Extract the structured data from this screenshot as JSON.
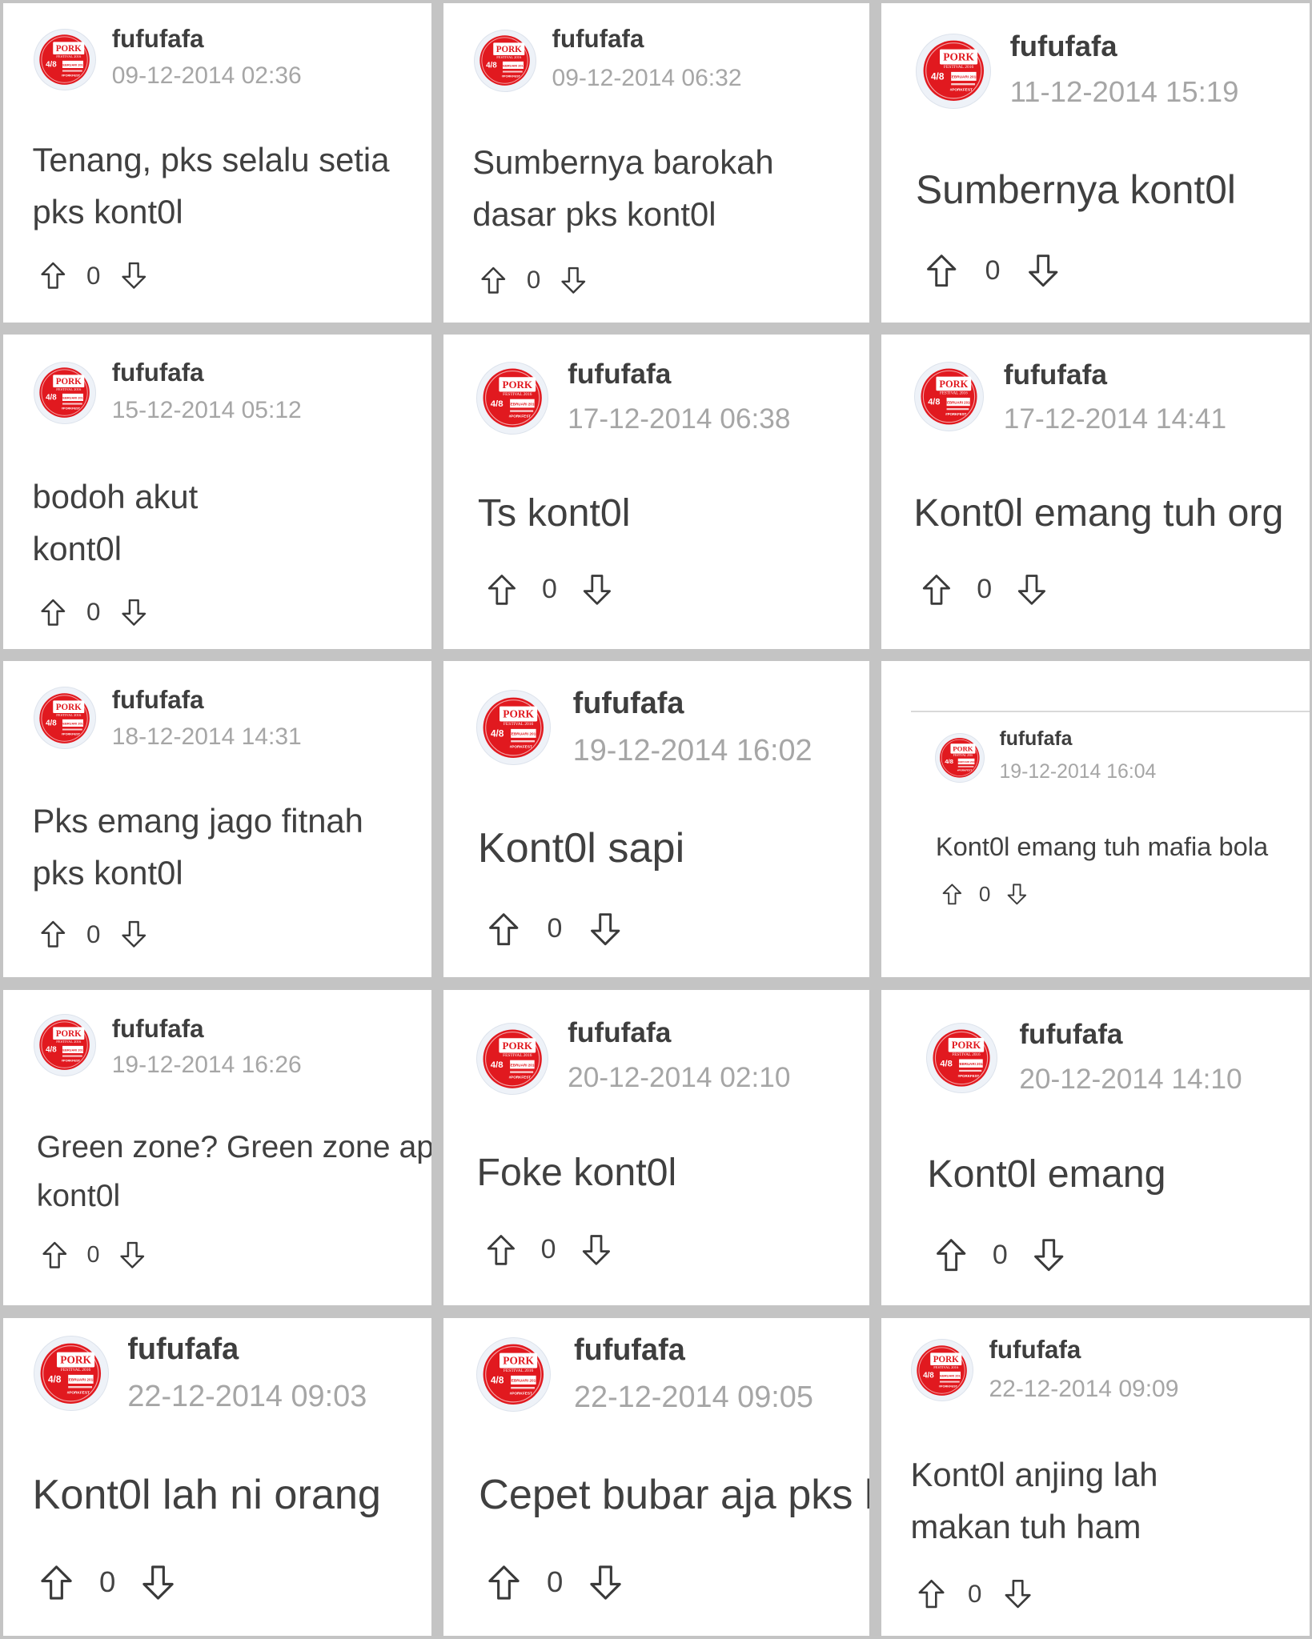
{
  "colors": {
    "background": "#c4c4c4",
    "card": "#ffffff",
    "username": "#3e3e3e",
    "timestamp": "#a6a6a6",
    "body_text": "#404040",
    "avatar_red": "#e1191f"
  },
  "icons": {
    "avatar": "pork-festival-badge",
    "upvote": "arrow-up-outline-icon",
    "downvote": "arrow-down-outline-icon"
  },
  "avatar_badge": {
    "title": "PORK",
    "subtitle": "FESTIVAL 2016",
    "date": "4/8",
    "month": "FEBRUARI 2016",
    "tag": "#PORKFEST"
  },
  "comments": [
    {
      "username": "fufufafa",
      "timestamp": "09-12-2014 02:36",
      "body": [
        "Tenang, pks selalu setia",
        "pks kont0l"
      ],
      "votes": "0"
    },
    {
      "username": "fufufafa",
      "timestamp": "09-12-2014 06:32",
      "body": [
        "Sumbernya barokah",
        "dasar pks kont0l"
      ],
      "votes": "0"
    },
    {
      "username": "fufufafa",
      "timestamp": "11-12-2014 15:19",
      "body": [
        "Sumbernya kont0l"
      ],
      "votes": "0"
    },
    {
      "username": "fufufafa",
      "timestamp": "15-12-2014 05:12",
      "body": [
        "bodoh akut",
        "kont0l"
      ],
      "votes": "0"
    },
    {
      "username": "fufufafa",
      "timestamp": "17-12-2014 06:38",
      "body": [
        "Ts kont0l"
      ],
      "votes": "0"
    },
    {
      "username": "fufufafa",
      "timestamp": "17-12-2014 14:41",
      "body": [
        "Kont0l emang tuh org"
      ],
      "votes": "0"
    },
    {
      "username": "fufufafa",
      "timestamp": "18-12-2014 14:31",
      "body": [
        "Pks emang jago fitnah",
        "pks kont0l"
      ],
      "votes": "0"
    },
    {
      "username": "fufufafa",
      "timestamp": "19-12-2014 16:02",
      "body": [
        "Kont0l sapi"
      ],
      "votes": "0"
    },
    {
      "username": "fufufafa",
      "timestamp": "19-12-2014 16:04",
      "body": [
        "Kont0l emang tuh mafia bola"
      ],
      "votes": "0"
    },
    {
      "username": "fufufafa",
      "timestamp": "19-12-2014 16:26",
      "body": [
        "Green zone? Green zone ap",
        "kont0l"
      ],
      "votes": "0"
    },
    {
      "username": "fufufafa",
      "timestamp": "20-12-2014 02:10",
      "body": [
        "Foke kont0l"
      ],
      "votes": "0"
    },
    {
      "username": "fufufafa",
      "timestamp": "20-12-2014 14:10",
      "body": [
        "Kont0l emang"
      ],
      "votes": "0"
    },
    {
      "username": "fufufafa",
      "timestamp": "22-12-2014 09:03",
      "body": [
        "Kont0l lah ni orang"
      ],
      "votes": "0"
    },
    {
      "username": "fufufafa",
      "timestamp": "22-12-2014 09:05",
      "body": [
        "Cepet bubar aja pks k"
      ],
      "votes": "0"
    },
    {
      "username": "fufufafa",
      "timestamp": "22-12-2014 09:09",
      "body": [
        "Kont0l anjing lah",
        "makan tuh ham"
      ],
      "votes": "0"
    }
  ]
}
